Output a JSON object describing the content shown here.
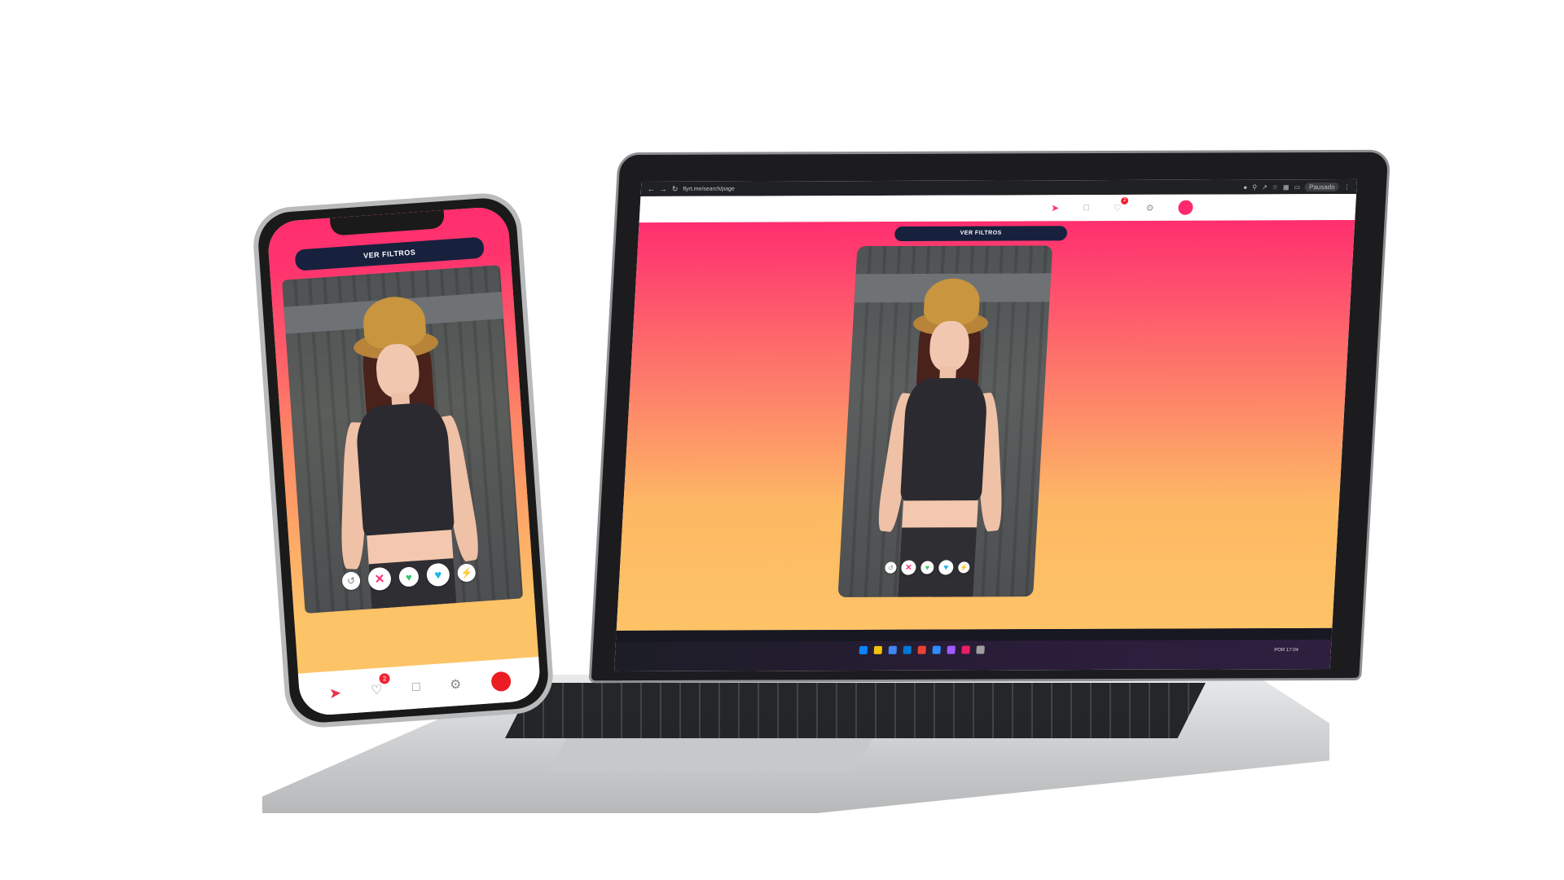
{
  "laptop": {
    "browser": {
      "url": "flyrt.me/search/page",
      "profile_label": "Pausado"
    },
    "header": {
      "likes_badge": "2"
    },
    "filters_label": "VER FILTROS",
    "taskbar": {
      "lang": "POR",
      "time": "17:04"
    }
  },
  "phone": {
    "filters_label": "VER FILTROS",
    "nav": {
      "likes_badge": "2"
    }
  },
  "colors": {
    "brand_pink": "#ff2e6f",
    "gradient_orange": "#fdc366",
    "button_navy": "#17213d",
    "avatar_red": "#ec1c24",
    "dislike": "#ff2e6f",
    "like_green": "#35c96a",
    "super_like_blue": "#19b7e8",
    "boost_yellow": "#f3c21b"
  },
  "icons": {
    "rewind": "rewind-icon",
    "dislike": "close-icon",
    "like": "heart-icon",
    "super_like": "heart-icon",
    "boost": "lightning-icon",
    "messages": "chat-icon",
    "settings": "gear-icon",
    "logo": "flame-logo-icon"
  }
}
